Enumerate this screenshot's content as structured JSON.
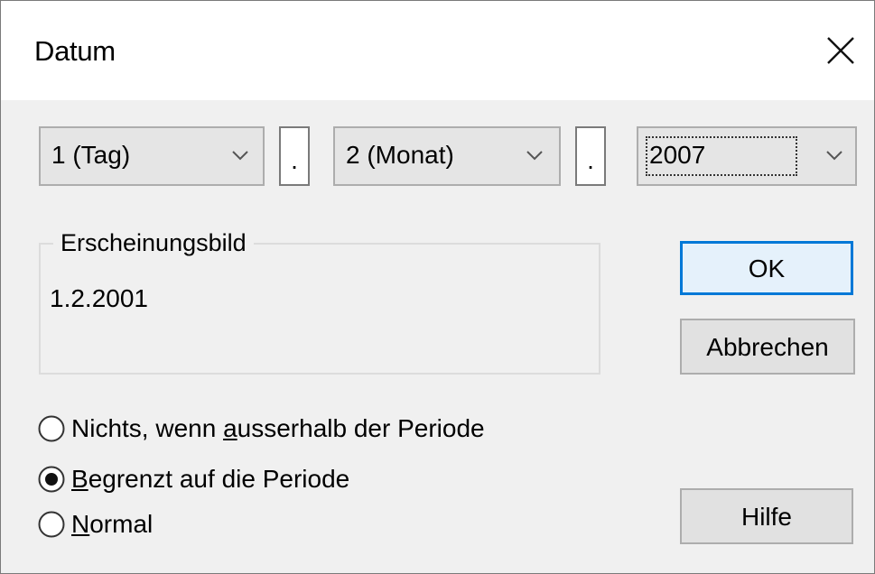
{
  "window": {
    "title": "Datum"
  },
  "date_parts": {
    "day": "1 (Tag)",
    "sep1": ".",
    "month": "2 (Monat)",
    "sep2": ".",
    "year": "2007"
  },
  "appearance": {
    "label": "Erscheinungsbild",
    "preview": "1.2.2001"
  },
  "buttons": {
    "ok": "OK",
    "cancel": "Abbrechen",
    "help": "Hilfe"
  },
  "options": [
    {
      "pre": "Nichts, wenn ",
      "u": "a",
      "post": "usserhalb der Periode",
      "checked": false
    },
    {
      "pre": "",
      "u": "B",
      "post": "egrenzt auf die Periode",
      "checked": true
    },
    {
      "pre": "",
      "u": "N",
      "post": "ormal",
      "checked": false
    }
  ],
  "colors": {
    "accent": "#0078d7",
    "dialog_bg": "#f0f0f0"
  }
}
